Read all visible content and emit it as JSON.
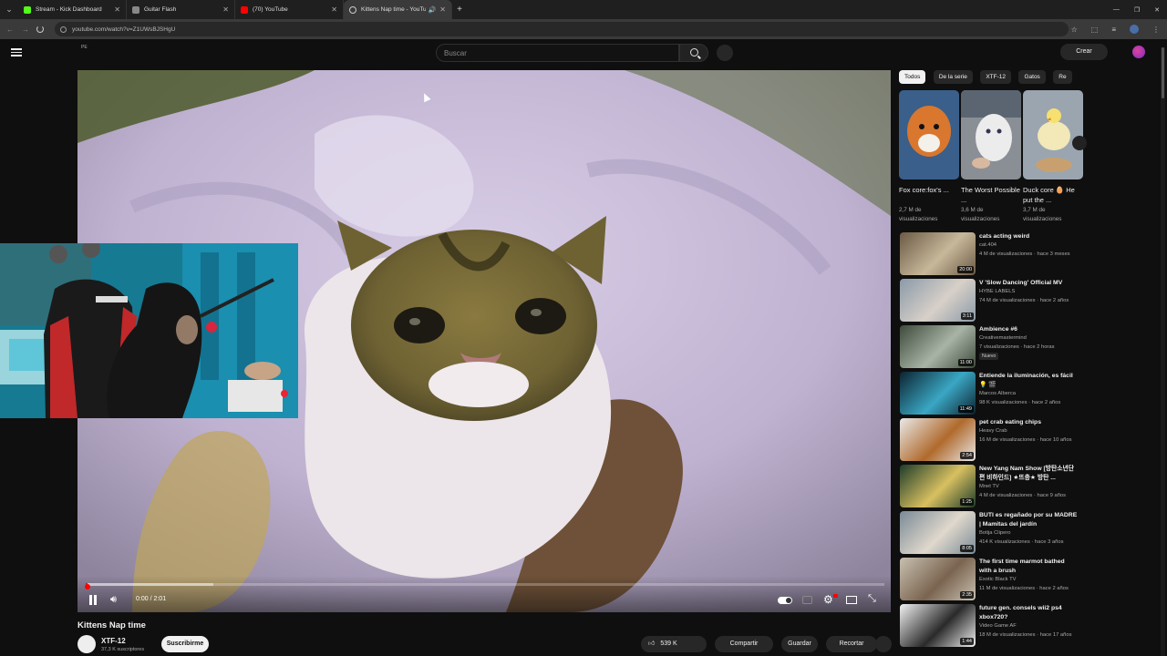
{
  "browser": {
    "tabs": [
      {
        "title": "Stream - Kick Dashboard",
        "favicon_color": "#53fc18"
      },
      {
        "title": "Guitar Flash",
        "favicon_color": "#888888"
      },
      {
        "title": "(70) YouTube",
        "favicon_color": "#ff0000"
      },
      {
        "title": "Kittens Nap time - YouTube",
        "favicon_color": "#cccccc",
        "active": true
      }
    ],
    "url": "youtube.com/watch?v=Z1UWsBJSHgU"
  },
  "header": {
    "region": "PE",
    "search_placeholder": "Buscar",
    "create_label": "Crear"
  },
  "player": {
    "time": "0:00 / 2:01",
    "progress_played": 0.002,
    "progress_buffered": 0.16
  },
  "video": {
    "title": "Kittens Nap time",
    "channel": "XTF-12",
    "subscribers": "37,3 K suscriptores",
    "subscribe_label": "Suscribirme",
    "likes": "539 K",
    "share_label": "Compartir",
    "save_label": "Guardar",
    "clip_label": "Recortar"
  },
  "chips": [
    "Todos",
    "De la serie",
    "XTF-12",
    "Gatos",
    "Re"
  ],
  "shorts": [
    {
      "title": "Fox core:fox's ...",
      "views": "2,7 M de visualizaciones",
      "c1": "#d9772e",
      "c2": "#f4f0ea"
    },
    {
      "title": "The Worst Possible ...",
      "views": "3,6 M de visualizaciones",
      "c1": "#e6e6e6",
      "c2": "#8a8f96"
    },
    {
      "title": "Duck core 🥚 He put the ...",
      "views": "3,7 M de visualizaciones",
      "c1": "#efe7c8",
      "c2": "#9aa5b0"
    }
  ],
  "recommendations": [
    {
      "title": "cats acting weird",
      "channel": "cat.404",
      "meta": "4 M de visualizaciones · hace 3 meses",
      "duration": "20:00",
      "c1": "#6b5a45",
      "c2": "#c8b89a"
    },
    {
      "title": "V 'Slow Dancing' Official MV",
      "channel": "HYBE LABELS",
      "meta": "74 M de visualizaciones · hace 2 años",
      "duration": "3:11",
      "c1": "#8a9aa8",
      "c2": "#d8d0c8"
    },
    {
      "title": "Ambience #6",
      "channel": "Creativemastermind",
      "meta": "7 visualizaciones · hace 2 horas",
      "duration": "11:00",
      "badge": "Nuevo",
      "c1": "#3e4a3a",
      "c2": "#a8b4a6"
    },
    {
      "title": "Entiende la iluminación, es fácil 💡 🎬",
      "channel": "Marcos Alberca",
      "meta": "98 K visualizaciones · hace 2 años",
      "duration": "11:49",
      "c1": "#0c2430",
      "c2": "#3aa7c4"
    },
    {
      "title": "pet crab eating chips",
      "channel": "Heavy Crab",
      "meta": "16 M de visualizaciones · hace 10 años",
      "duration": "2:54",
      "c1": "#e9e9e9",
      "c2": "#b06a2c"
    },
    {
      "title": "New Yang Nam Show [방탄소년단편 비하인드] ★뜨충★ 방탄 ...",
      "channel": "Mnet TV",
      "meta": "4 M de visualizaciones · hace 9 años",
      "duration": "1:25",
      "c1": "#1d3c2a",
      "c2": "#d8c060"
    },
    {
      "title": "BUTI es regañado por su MADRE | Mamitas del jardín",
      "channel": "Botija Clipero",
      "meta": "414 K visualizaciones · hace 3 años",
      "duration": "8:05",
      "c1": "#7a8a96",
      "c2": "#e0d8cc"
    },
    {
      "title": "The first time marmot bathed with a brush",
      "channel": "Exotic Black TV",
      "meta": "11 M de visualizaciones · hace 2 años",
      "duration": "2:35",
      "c1": "#c8c0b0",
      "c2": "#7a6450"
    },
    {
      "title": "future gen. consels wii2 ps4 xbox720?",
      "channel": "Video Game AF",
      "meta": "18 M de visualizaciones · hace 17 años",
      "duration": "1:44",
      "c1": "#f2f2f2",
      "c2": "#2a2a2a"
    }
  ]
}
